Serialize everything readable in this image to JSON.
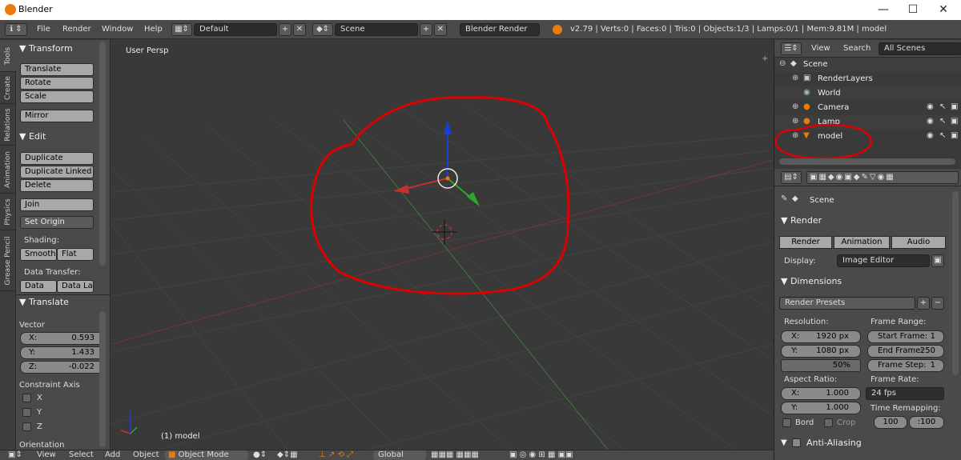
{
  "window": {
    "title": "Blender",
    "min_glyph": "—",
    "max_glyph": "☐",
    "close_glyph": "✕"
  },
  "header": {
    "menus": [
      "File",
      "Render",
      "Window",
      "Help"
    ],
    "layout": "Default",
    "scene": "Scene",
    "engine": "Blender Render",
    "stats": "v2.79 | Verts:0 | Faces:0 | Tris:0 | Objects:1/3 | Lamps:0/1 | Mem:9.81M | model"
  },
  "left_tabs": [
    "Tools",
    "Create",
    "Relations",
    "Animation",
    "Physics",
    "Grease Pencil"
  ],
  "tools": {
    "transform_header": "▼ Transform",
    "translate": "Translate",
    "rotate": "Rotate",
    "scale": "Scale",
    "mirror": "Mirror",
    "edit_header": "▼ Edit",
    "duplicate": "Duplicate",
    "duplicate_linked": "Duplicate Linked",
    "delete": "Delete",
    "join": "Join",
    "set_origin": "Set Origin",
    "shading_label": "Shading:",
    "smooth": "Smooth",
    "flat": "Flat",
    "data_transfer_label": "Data Transfer:",
    "data": "Data",
    "data_layout": "Data La"
  },
  "translate_panel": {
    "header": "▼ Translate",
    "vector_label": "Vector",
    "x_label": "X:",
    "x": "0.593",
    "y_label": "Y:",
    "y": "1.433",
    "z_label": "Z:",
    "z": "-0.022",
    "constraint_label": "Constraint Axis",
    "axis_x": "X",
    "axis_y": "Y",
    "axis_z": "Z",
    "orientation_label": "Orientation"
  },
  "viewport": {
    "label": "User Persp",
    "object_label": "(1) model"
  },
  "outliner": {
    "view": "View",
    "search": "Search",
    "filter": "All Scenes",
    "items": [
      {
        "label": "Scene"
      },
      {
        "label": "RenderLayers"
      },
      {
        "label": "World"
      },
      {
        "label": "Camera"
      },
      {
        "label": "Lamp"
      },
      {
        "label": "model"
      }
    ]
  },
  "properties": {
    "context": "Scene",
    "render_header": "▼ Render",
    "render_btn": "Render",
    "animation_btn": "Animation",
    "audio_btn": "Audio",
    "display_label": "Display:",
    "display_value": "Image Editor",
    "dimensions_header": "▼ Dimensions",
    "render_presets": "Render Presets",
    "resolution_label": "Resolution:",
    "res_x_label": "X:",
    "res_x": "1920 px",
    "res_y_label": "Y:",
    "res_y": "1080 px",
    "res_pct": "50%",
    "frame_range_label": "Frame Range:",
    "start_frame": "Start Frame:",
    "start_frame_val": "1",
    "end_frame": "End Frame:",
    "end_frame_val": "250",
    "frame_step": "Frame Step:",
    "frame_step_val": "1",
    "aspect_label": "Aspect Ratio:",
    "asp_x_label": "X:",
    "asp_x": "1.000",
    "asp_y_label": "Y:",
    "asp_y": "1.000",
    "frame_rate_label": "Frame Rate:",
    "fps": "24 fps",
    "time_remap_label": "Time Remapping:",
    "remap_old": "100",
    "remap_new": ":100",
    "bord": "Bord",
    "crop": "Crop",
    "aa_header": "Anti-Aliasing"
  },
  "bottom": {
    "view": "View",
    "select": "Select",
    "add": "Add",
    "object": "Object",
    "mode": "Object Mode",
    "orientation": "Global"
  },
  "colors": {
    "accent_orange": "#e87d0d",
    "annotation_red": "#e00000",
    "axis_red": "#c62f2f",
    "axis_green": "#2ea62e",
    "axis_blue": "#1a3fd6"
  }
}
